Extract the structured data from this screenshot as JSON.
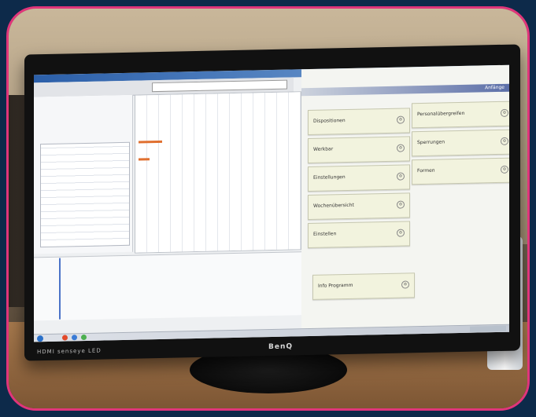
{
  "monitor": {
    "brand": "BenQ",
    "model": "HDMI senseye LED"
  },
  "app": {
    "title": "",
    "menu": [
      "",
      "",
      "",
      "",
      "",
      ""
    ],
    "left_pane_label": ""
  },
  "launcher": {
    "header_label": "Anfänge",
    "tiles_left": [
      {
        "label": "Dispositionen",
        "icon": "gear-icon"
      },
      {
        "label": "Werkbar",
        "icon": "gear-icon"
      },
      {
        "label": "Einstellungen",
        "icon": "gear-icon"
      },
      {
        "label": "Wochenübersicht",
        "icon": "gear-icon"
      },
      {
        "label": "Einstellen",
        "icon": "gear-icon"
      }
    ],
    "tiles_right": [
      {
        "label": "Personalübergreifen",
        "icon": "gear-icon"
      },
      {
        "label": "Sperrungen",
        "icon": "gear-icon"
      },
      {
        "label": "Formen",
        "icon": "gear-icon"
      }
    ],
    "bottom_tile": {
      "label": "Info Programm",
      "icon": "gear-icon"
    }
  }
}
